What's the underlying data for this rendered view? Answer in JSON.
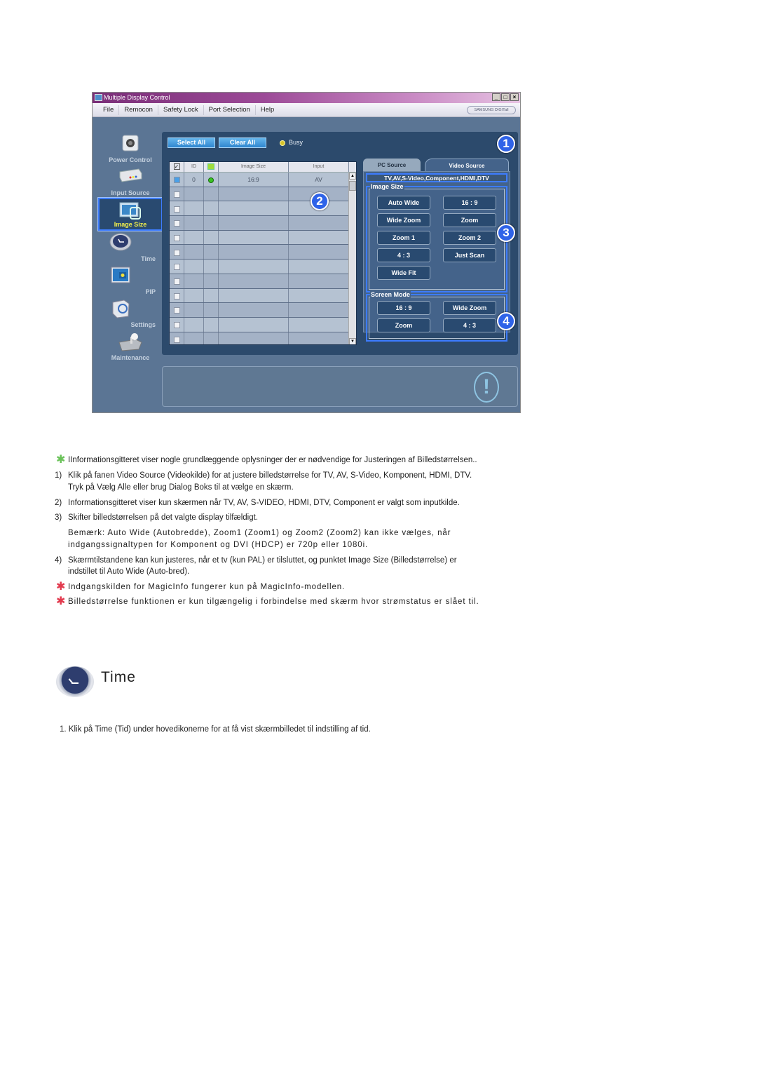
{
  "window": {
    "title": "Multiple Display Control",
    "controls": [
      "_",
      "□",
      "×"
    ],
    "menu": [
      "File",
      "Remocon",
      "Safety Lock",
      "Port Selection",
      "Help"
    ],
    "brand": "SAMSUNG DIGITall"
  },
  "nav": [
    {
      "label": "Power Control",
      "icon": "power-control-icon",
      "active": false
    },
    {
      "label": "Input Source",
      "icon": "input-source-icon",
      "active": false
    },
    {
      "label": "Image Size",
      "icon": "image-size-icon",
      "active": true
    },
    {
      "label": "Time",
      "icon": "clock-icon",
      "active": false
    },
    {
      "label": "PIP",
      "icon": "pip-icon",
      "active": false
    },
    {
      "label": "Settings",
      "icon": "settings-icon",
      "active": false
    },
    {
      "label": "Maintenance",
      "icon": "maintenance-icon",
      "active": false
    }
  ],
  "toolbar": {
    "select_all": "Select All",
    "clear_all": "Clear All",
    "busy": "Busy"
  },
  "grid": {
    "columns": [
      "",
      "ID",
      "",
      "Image Size",
      "Input"
    ],
    "rows": [
      {
        "checked": true,
        "id": "0",
        "power": "on",
        "image_size": "16:9",
        "input": "AV"
      },
      {
        "checked": false,
        "id": "",
        "power": "",
        "image_size": "",
        "input": ""
      },
      {
        "checked": false,
        "id": "",
        "power": "",
        "image_size": "",
        "input": ""
      },
      {
        "checked": false,
        "id": "",
        "power": "",
        "image_size": "",
        "input": ""
      },
      {
        "checked": false,
        "id": "",
        "power": "",
        "image_size": "",
        "input": ""
      },
      {
        "checked": false,
        "id": "",
        "power": "",
        "image_size": "",
        "input": ""
      },
      {
        "checked": false,
        "id": "",
        "power": "",
        "image_size": "",
        "input": ""
      },
      {
        "checked": false,
        "id": "",
        "power": "",
        "image_size": "",
        "input": ""
      },
      {
        "checked": false,
        "id": "",
        "power": "",
        "image_size": "",
        "input": ""
      },
      {
        "checked": false,
        "id": "",
        "power": "",
        "image_size": "",
        "input": ""
      },
      {
        "checked": false,
        "id": "",
        "power": "",
        "image_size": "",
        "input": ""
      },
      {
        "checked": false,
        "id": "",
        "power": "",
        "image_size": "",
        "input": ""
      }
    ]
  },
  "tabs": {
    "pc_source": "PC Source",
    "video_source": "Video Source",
    "active": "video_source"
  },
  "video_panel": {
    "sources": "TV,AV,S-Video,Component,HDMI,DTV",
    "image_size": {
      "title": "Image Size",
      "buttons": [
        "Auto Wide",
        "16 : 9",
        "Wide Zoom",
        "Zoom",
        "Zoom 1",
        "Zoom 2",
        "4 : 3",
        "Just Scan",
        "Wide Fit"
      ]
    },
    "screen_mode": {
      "title": "Screen Mode",
      "buttons": [
        "16 : 9",
        "Wide Zoom",
        "Zoom",
        "4 : 3"
      ]
    }
  },
  "callouts": [
    "1",
    "2",
    "3",
    "4"
  ],
  "doc": {
    "intro": "IInformationsgitteret viser nogle grundlæggende oplysninger der er nødvendige for Justeringen af Billedstørrelsen..",
    "steps": [
      {
        "num": "1)",
        "lines": [
          "Klik på fanen Video Source (Videokilde) for at justere billedstørrelse for TV, AV, S-Video, Komponent, HDMI, DTV.",
          "Tryk på Vælg Alle eller brug Dialog Boks til at vælge en skærm."
        ]
      },
      {
        "num": "2)",
        "lines": [
          "Informationsgitteret viser kun skærmen når TV, AV, S-VIDEO, HDMI, DTV, Component er valgt som inputkilde."
        ]
      },
      {
        "num": "3)",
        "lines": [
          "Skifter billedstørrelsen på det valgte display tilfældigt."
        ]
      }
    ],
    "note": [
      "Bemærk: Auto Wide (Autobredde), Zoom1 (Zoom1) og Zoom2 (Zoom2) kan ikke vælges, når",
      "indgangssignaltypen for Komponent og DVI (HDCP) er 720p eller 1080i."
    ],
    "step4": {
      "num": "4)",
      "lines": [
        "Skærmtilstandene kan kun justeres, når et tv (kun PAL) er tilsluttet, og punktet Image Size (Billedstørrelse) er",
        "indstillet til Auto Wide (Auto-bred)."
      ]
    },
    "notes_red": [
      "Indgangskilden for MagicInfo fungerer kun på MagicInfo-modellen.",
      "Billedstørrelse funktionen er kun tilgængelig i forbindelse med skærm hvor strømstatus er slået til."
    ],
    "star": "✱"
  },
  "time_section": {
    "title": "Time",
    "step": "1.  Klik på Time (Tid) under hovedikonerne for at få vist skærmbilledet til indstilling af tid."
  }
}
